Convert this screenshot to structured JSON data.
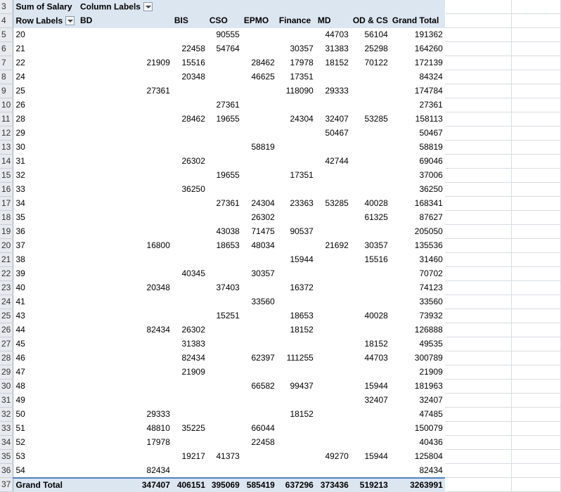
{
  "pivot": {
    "title": "Sum of Salary",
    "column_labels": "Column Labels",
    "row_labels": "Row Labels",
    "columns": [
      "BD",
      "BIS",
      "CSO",
      "EPMO",
      "Finance",
      "MD",
      "OD & CS",
      "Grand Total"
    ],
    "row_numbers": [
      "3",
      "4",
      "5",
      "6",
      "7",
      "8",
      "9",
      "10",
      "11",
      "12",
      "13",
      "14",
      "15",
      "16",
      "17",
      "18",
      "19",
      "20",
      "21",
      "22",
      "23",
      "24",
      "25",
      "26",
      "27",
      "28",
      "29",
      "30",
      "31",
      "32",
      "33",
      "34",
      "35",
      "36",
      "37"
    ],
    "rows": [
      [
        "20",
        "",
        "",
        "90555",
        "",
        "",
        "44703",
        "56104",
        "191362"
      ],
      [
        "21",
        "",
        "22458",
        "54764",
        "",
        "30357",
        "31383",
        "25298",
        "164260"
      ],
      [
        "22",
        "21909",
        "15516",
        "",
        "28462",
        "17978",
        "18152",
        "70122",
        "172139"
      ],
      [
        "24",
        "",
        "20348",
        "",
        "46625",
        "17351",
        "",
        "",
        "84324"
      ],
      [
        "25",
        "27361",
        "",
        "",
        "",
        "118090",
        "29333",
        "",
        "174784"
      ],
      [
        "26",
        "",
        "",
        "27361",
        "",
        "",
        "",
        "",
        "27361"
      ],
      [
        "28",
        "",
        "28462",
        "19655",
        "",
        "24304",
        "32407",
        "53285",
        "158113"
      ],
      [
        "29",
        "",
        "",
        "",
        "",
        "",
        "50467",
        "",
        "50467"
      ],
      [
        "30",
        "",
        "",
        "",
        "58819",
        "",
        "",
        "",
        "58819"
      ],
      [
        "31",
        "",
        "26302",
        "",
        "",
        "",
        "42744",
        "",
        "69046"
      ],
      [
        "32",
        "",
        "",
        "19655",
        "",
        "17351",
        "",
        "",
        "37006"
      ],
      [
        "33",
        "",
        "36250",
        "",
        "",
        "",
        "",
        "",
        "36250"
      ],
      [
        "34",
        "",
        "",
        "27361",
        "24304",
        "23363",
        "53285",
        "40028",
        "168341"
      ],
      [
        "35",
        "",
        "",
        "",
        "26302",
        "",
        "",
        "61325",
        "87627"
      ],
      [
        "36",
        "",
        "",
        "43038",
        "71475",
        "90537",
        "",
        "",
        "205050"
      ],
      [
        "37",
        "16800",
        "",
        "18653",
        "48034",
        "",
        "21692",
        "30357",
        "135536"
      ],
      [
        "38",
        "",
        "",
        "",
        "",
        "15944",
        "",
        "15516",
        "31460"
      ],
      [
        "39",
        "",
        "40345",
        "",
        "30357",
        "",
        "",
        "",
        "70702"
      ],
      [
        "40",
        "20348",
        "",
        "37403",
        "",
        "16372",
        "",
        "",
        "74123"
      ],
      [
        "41",
        "",
        "",
        "",
        "33560",
        "",
        "",
        "",
        "33560"
      ],
      [
        "43",
        "",
        "",
        "15251",
        "",
        "18653",
        "",
        "40028",
        "73932"
      ],
      [
        "44",
        "82434",
        "26302",
        "",
        "",
        "18152",
        "",
        "",
        "126888"
      ],
      [
        "45",
        "",
        "31383",
        "",
        "",
        "",
        "",
        "18152",
        "49535"
      ],
      [
        "46",
        "",
        "82434",
        "",
        "62397",
        "111255",
        "",
        "44703",
        "300789"
      ],
      [
        "47",
        "",
        "21909",
        "",
        "",
        "",
        "",
        "",
        "21909"
      ],
      [
        "48",
        "",
        "",
        "",
        "66582",
        "99437",
        "",
        "15944",
        "181963"
      ],
      [
        "49",
        "",
        "",
        "",
        "",
        "",
        "",
        "32407",
        "32407"
      ],
      [
        "50",
        "29333",
        "",
        "",
        "",
        "18152",
        "",
        "",
        "47485"
      ],
      [
        "51",
        "48810",
        "35225",
        "",
        "66044",
        "",
        "",
        "",
        "150079"
      ],
      [
        "52",
        "17978",
        "",
        "",
        "22458",
        "",
        "",
        "",
        "40436"
      ],
      [
        "53",
        "",
        "19217",
        "41373",
        "",
        "",
        "49270",
        "15944",
        "125804"
      ],
      [
        "54",
        "82434",
        "",
        "",
        "",
        "",
        "",
        "",
        "82434"
      ]
    ],
    "grand_total_label": "Grand Total",
    "grand_total": [
      "347407",
      "406151",
      "395069",
      "585419",
      "637296",
      "373436",
      "519213",
      "3263991"
    ]
  },
  "colors": {
    "header_fill": "#dce6f1",
    "row_header_fill": "#e7eaee",
    "total_border": "#4f81bd",
    "grid": "#d8dce2"
  }
}
